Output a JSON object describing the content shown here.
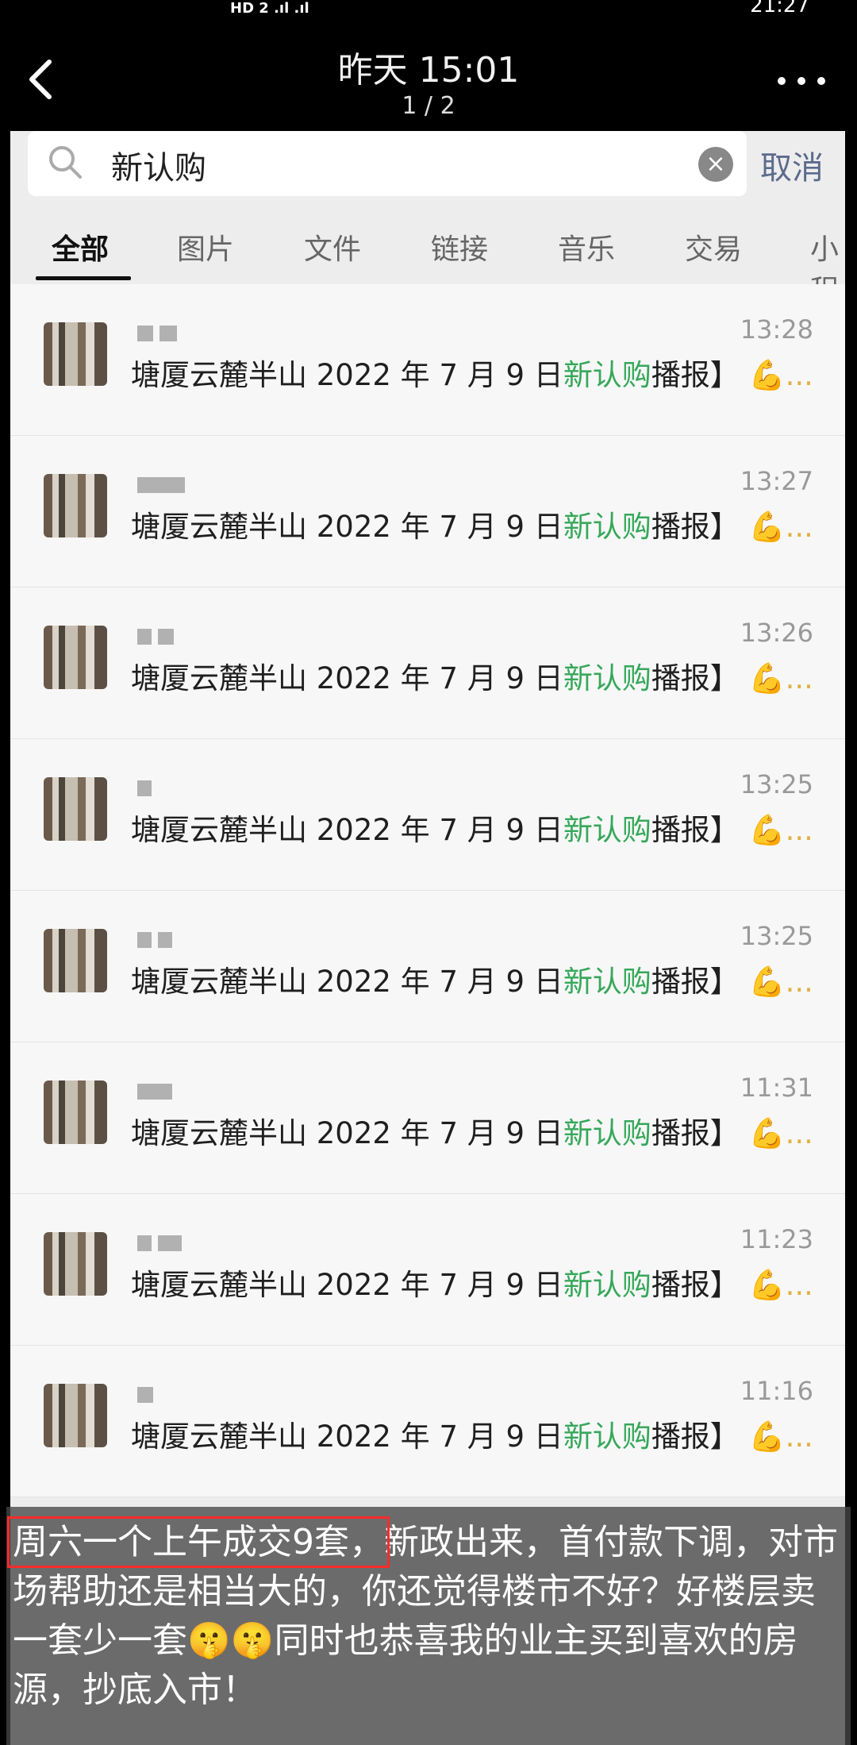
{
  "viewer": {
    "title": "昨天 15:01",
    "pager": "1 / 2"
  },
  "statusbar": {
    "left": "HD 2 .ıl .ıl",
    "right": "21:27"
  },
  "search": {
    "query": "新认购",
    "cancel_label": "取消"
  },
  "tabs": [
    "全部",
    "图片",
    "文件",
    "链接",
    "音乐",
    "交易",
    "小程"
  ],
  "results": [
    {
      "time": "13:28",
      "prefix": "塘厦云麓半山 2022 年 7 月 9 日",
      "highlight": "新认购",
      "suffix": "播报】",
      "tail": "💪..."
    },
    {
      "time": "13:27",
      "prefix": "塘厦云麓半山 2022 年 7 月 9 日",
      "highlight": "新认购",
      "suffix": "播报】",
      "tail": "💪..."
    },
    {
      "time": "13:26",
      "prefix": "塘厦云麓半山 2022 年 7 月 9 日",
      "highlight": "新认购",
      "suffix": "播报】",
      "tail": "💪..."
    },
    {
      "time": "13:25",
      "prefix": "塘厦云麓半山 2022 年 7 月 9 日",
      "highlight": "新认购",
      "suffix": "播报】",
      "tail": "💪..."
    },
    {
      "time": "13:25",
      "prefix": "塘厦云麓半山 2022 年 7 月 9 日",
      "highlight": "新认购",
      "suffix": "播报】",
      "tail": "💪..."
    },
    {
      "time": "11:31",
      "prefix": "塘厦云麓半山 2022 年 7 月 9 日",
      "highlight": "新认购",
      "suffix": "播报】",
      "tail": "💪..."
    },
    {
      "time": "11:23",
      "prefix": "塘厦云麓半山 2022 年 7 月 9 日",
      "highlight": "新认购",
      "suffix": "播报】",
      "tail": "💪..."
    },
    {
      "time": "11:16",
      "prefix": "塘厦云麓半山 2022 年 7 月 9 日",
      "highlight": "新认购",
      "suffix": "播报】",
      "tail": "💪..."
    }
  ],
  "caption": {
    "boxed": "周六一个上午成交9套，",
    "rest": "新政出来，首付款下调，对市场帮助还是相当大的，你还觉得楼市不好？好楼层卖一套少一套🤫🤫同时也恭喜我的业主买到喜欢的房源，抄底入市！"
  }
}
